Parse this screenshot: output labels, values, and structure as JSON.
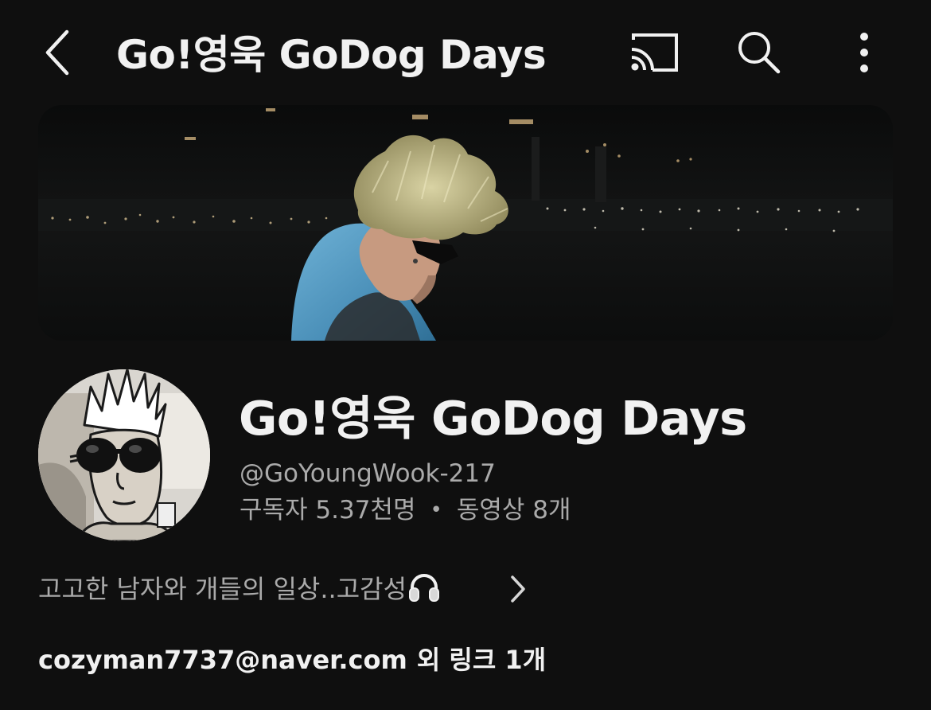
{
  "topbar": {
    "title": "Go!영욱 GoDog Days",
    "icons": {
      "back": "chevron-left-icon",
      "cast": "cast-icon",
      "search": "search-icon",
      "more": "more-vertical-icon"
    }
  },
  "banner": {
    "description": "channel-banner-image"
  },
  "channel": {
    "name": "Go!영욱 GoDog Days",
    "handle": "@GoYoungWook-217",
    "subscribers": "구독자 5.37천명",
    "separator": "•",
    "videos": "동영상 8개"
  },
  "description": {
    "text": "고고한 남자와 개들의 일상..고감성",
    "emoji_icon": "headphones-icon",
    "chevron_icon": "chevron-right-icon"
  },
  "links": {
    "email": "cozyman7737@naver.com",
    "extra": "외 링크 1개"
  },
  "colors": {
    "background": "#0f0f0f",
    "text_primary": "#f1f1f1",
    "text_secondary": "#aaaaaa",
    "hoodie_blue": "#5aa0c8",
    "hair_blond": "#c9c08a"
  }
}
